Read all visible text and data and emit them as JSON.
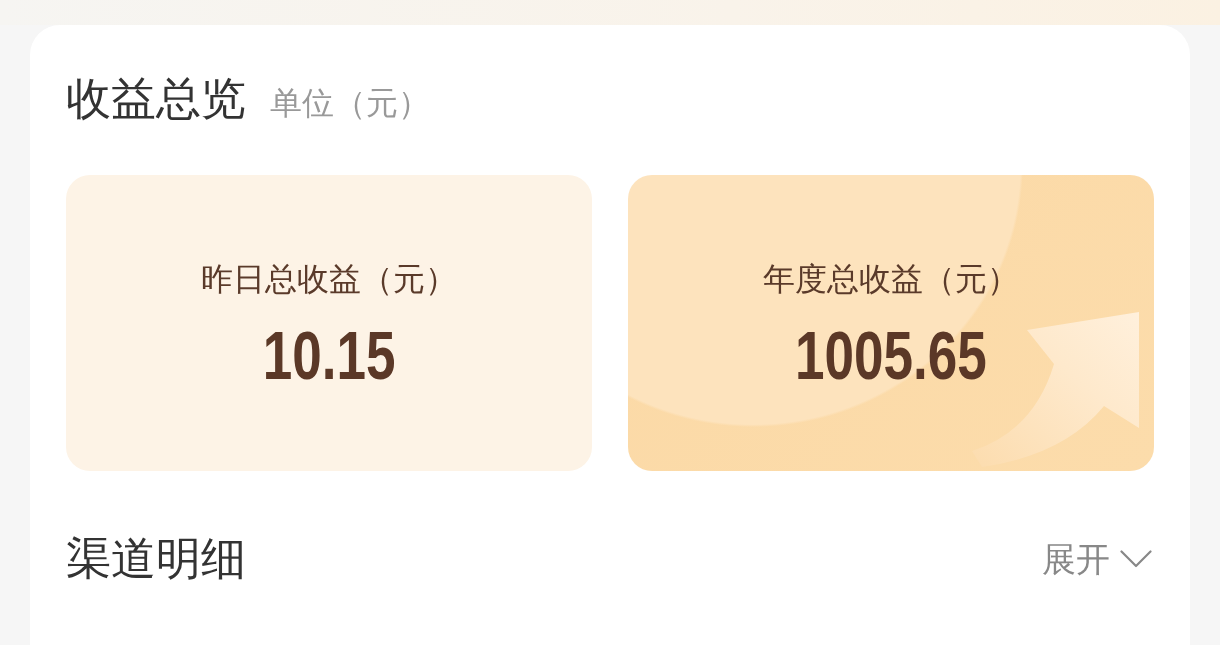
{
  "overview": {
    "title": "收益总览",
    "unit": "单位（元）",
    "tiles": [
      {
        "kind": "plain",
        "label": "昨日总收益（元）",
        "value": "10.15"
      },
      {
        "kind": "highlight",
        "label": "年度总收益（元）",
        "value": "1005.65"
      }
    ]
  },
  "channels": {
    "title": "渠道明细",
    "toggle": {
      "label": "展开",
      "expanded": false
    }
  }
}
